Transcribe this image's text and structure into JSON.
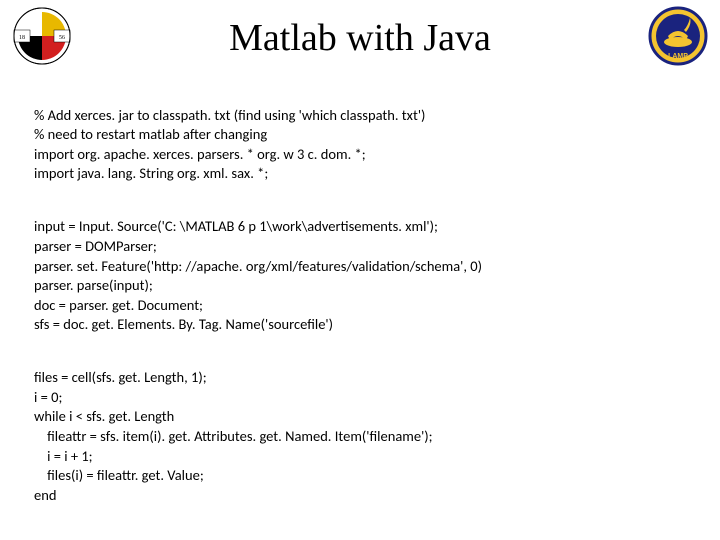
{
  "title": "Matlab with Java",
  "logos": {
    "left": {
      "name": "university-of-maryland-seal"
    },
    "right": {
      "name": "lamp-badge"
    }
  },
  "code": {
    "block1": "% Add xerces. jar to classpath. txt (find using 'which classpath. txt')\n% need to restart matlab after changing\nimport org. apache. xerces. parsers. * org. w 3 c. dom. *;\nimport java. lang. String org. xml. sax. *;",
    "block2": "input = Input. Source('C: \\MATLAB 6 p 1\\work\\advertisements. xml');\nparser = DOMParser;\nparser. set. Feature('http: //apache. org/xml/features/validation/schema', 0)\nparser. parse(input);\ndoc = parser. get. Document;\nsfs = doc. get. Elements. By. Tag. Name('sourcefile')",
    "block3": "files = cell(sfs. get. Length, 1);\ni = 0;\nwhile i < sfs. get. Length\n    fileattr = sfs. item(i). get. Attributes. get. Named. Item('filename');\n    i = i + 1;\n    files(i) = fileattr. get. Value;\nend"
  }
}
